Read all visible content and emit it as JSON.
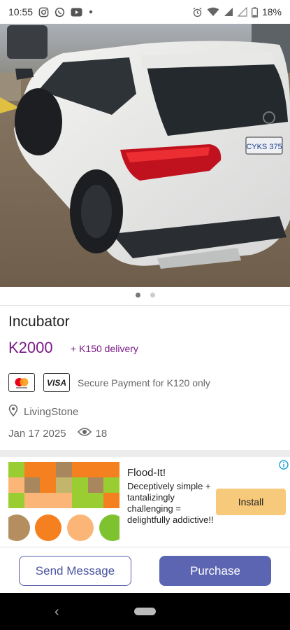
{
  "status_bar": {
    "time": "10:55",
    "notification_icons": [
      "instagram-icon",
      "whatsapp-icon",
      "youtube-icon",
      "dot-icon"
    ],
    "system_icons": [
      "alarm-icon",
      "wifi-icon",
      "signal-icon",
      "signal-weak-icon",
      "battery-icon"
    ],
    "battery": "18%"
  },
  "carousel": {
    "image_description_icon": "car-photo",
    "page_count": 2,
    "active_page": 1
  },
  "listing": {
    "title": "Incubator",
    "price": "K2000",
    "delivery": "+ K150 delivery",
    "payment_brands": [
      "mastercard-logo",
      "VISA"
    ],
    "secure_payment": "Secure Payment for K120 only",
    "location": "LivingStone",
    "date": "Jan 17 2025",
    "views": "18"
  },
  "ad": {
    "title": "Flood-It!",
    "description": "Deceptively simple + tantalizingly challenging = delightfully addictive!!",
    "install_label": "Install",
    "info_icon": "info-icon",
    "colors": {
      "green": "#9acd32",
      "orange": "#f4801f",
      "peach": "#fbb677",
      "brown": "#a8875e",
      "olive": "#c3b56b"
    }
  },
  "actions": {
    "send_message": "Send Message",
    "purchase": "Purchase",
    "accent_color": "#5b65b2"
  },
  "nav_bar": {
    "back_icon": "back-chevron-icon",
    "home_icon": "home-pill-icon"
  }
}
